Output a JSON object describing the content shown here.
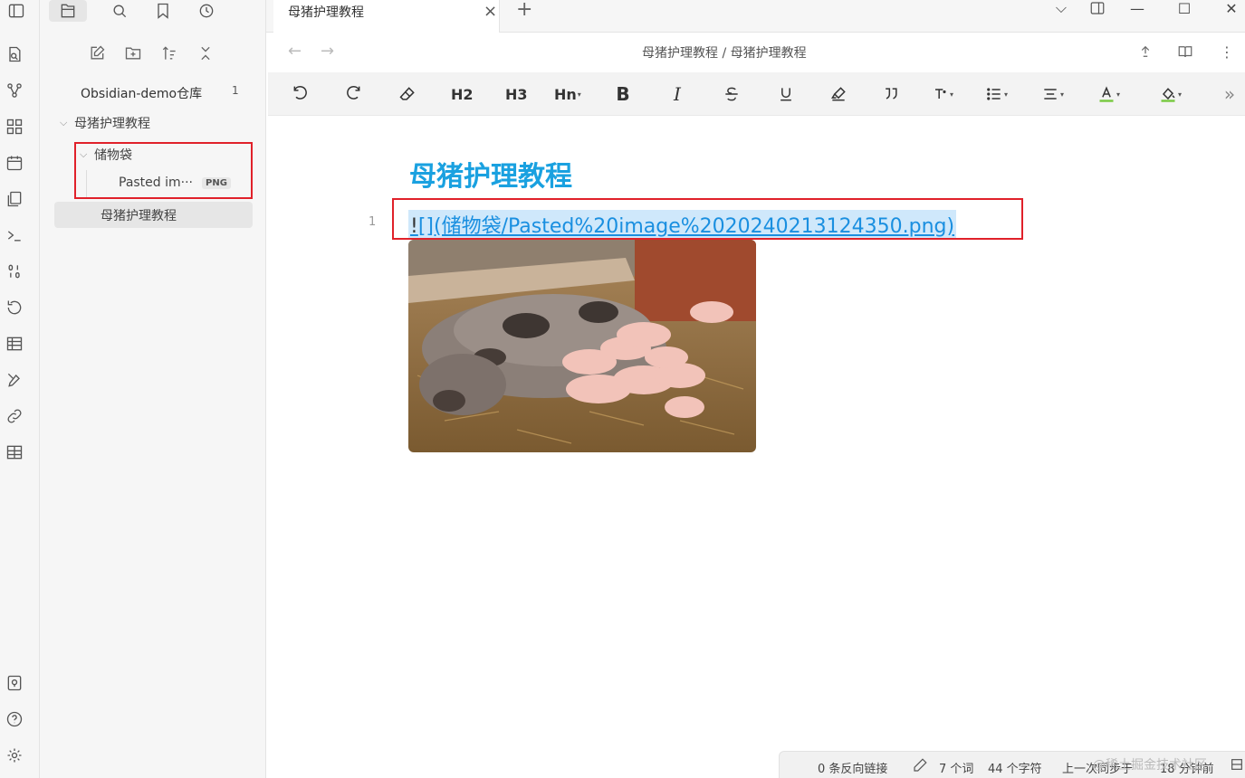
{
  "vault": {
    "name": "Obsidian-demo仓库",
    "count": "1"
  },
  "tree": {
    "folder": "母猪护理教程",
    "subfolder": "储物袋",
    "file_pasted": "Pasted im···",
    "file_badge": "PNG",
    "active_file": "母猪护理教程"
  },
  "tab": {
    "title": "母猪护理教程",
    "close": "×",
    "new": "+"
  },
  "breadcrumb": "母猪护理教程 / 母猪护理教程",
  "toolbar": {
    "h2": "H2",
    "h3": "H3",
    "hn": "Hn",
    "bold": "B",
    "italic": "I"
  },
  "editor": {
    "heading": "母猪护理教程",
    "line_number": "1",
    "link_bang": "!",
    "link_text": "[](储物袋/Pasted%20image%2020240213124350.png)"
  },
  "status": {
    "backlinks": "0 条反向链接",
    "words": "7 个词",
    "chars": "44 个字符",
    "sync": "上一次同步于",
    "time": "18 分钟前",
    "watermark": "@稀土掘金技术社区"
  },
  "colors": {
    "heading": "#1aa1e0",
    "link": "#1a8fe0",
    "highlight": "#cfe8fb",
    "annotation": "#e0212a"
  }
}
